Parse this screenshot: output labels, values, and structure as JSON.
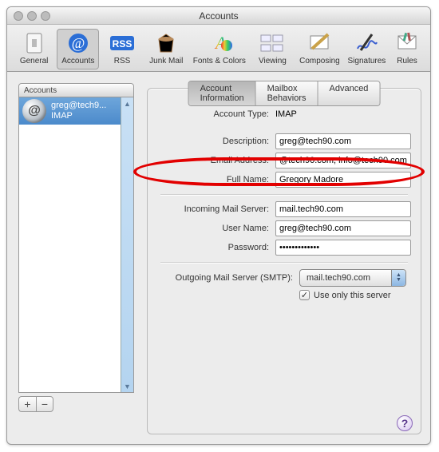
{
  "window": {
    "title": "Accounts"
  },
  "toolbar": [
    {
      "label": "General"
    },
    {
      "label": "Accounts"
    },
    {
      "label": "RSS"
    },
    {
      "label": "Junk Mail"
    },
    {
      "label": "Fonts & Colors"
    },
    {
      "label": "Viewing"
    },
    {
      "label": "Composing"
    },
    {
      "label": "Signatures"
    },
    {
      "label": "Rules"
    }
  ],
  "sidebar": {
    "header": "Accounts",
    "items": [
      {
        "title": "greg@tech9...",
        "subtitle": "IMAP"
      }
    ],
    "add": "+",
    "remove": "−"
  },
  "tabs": {
    "account_info": "Account Information",
    "mailbox_behaviors": "Mailbox Behaviors",
    "advanced": "Advanced"
  },
  "form": {
    "account_type_label": "Account Type:",
    "account_type_value": "IMAP",
    "description_label": "Description:",
    "description_value": "greg@tech90.com",
    "email_label": "Email Address:",
    "email_value": "@tech90.com, info@tech90.com",
    "fullname_label": "Full Name:",
    "fullname_value": "Gregory Madore",
    "incoming_label": "Incoming Mail Server:",
    "incoming_value": "mail.tech90.com",
    "username_label": "User Name:",
    "username_value": "greg@tech90.com",
    "password_label": "Password:",
    "password_value": "•••••••••••••",
    "smtp_label": "Outgoing Mail Server (SMTP):",
    "smtp_value": "mail.tech90.com",
    "use_only_label": "Use only this server",
    "use_only_checked": true
  },
  "help": "?"
}
